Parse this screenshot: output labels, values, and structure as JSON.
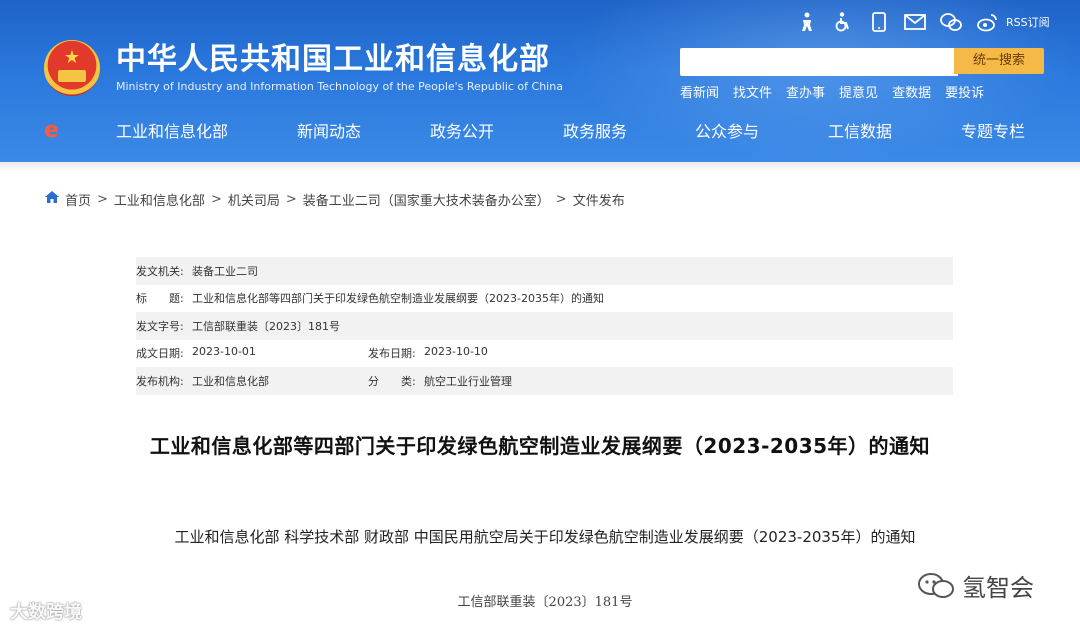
{
  "header": {
    "site_title": "中华人民共和国工业和信息化部",
    "site_subtitle": "Ministry of Industry and Information Technology of the People's Republic of China",
    "top_icons": [
      "elder-icon",
      "accessibility-icon",
      "mobile-icon",
      "mail-icon",
      "wechat-icon",
      "weibo-icon"
    ],
    "rss_label": "RSS订阅",
    "search": {
      "placeholder": "",
      "button_label": "统一搜索"
    },
    "quick_links": [
      "看新闻",
      "找文件",
      "查办事",
      "提意见",
      "查数据",
      "要投诉"
    ],
    "nav": [
      "工业和信息化部",
      "新闻动态",
      "政务公开",
      "政务服务",
      "公众参与",
      "工信数据",
      "专题专栏"
    ]
  },
  "breadcrumb": {
    "items": [
      "首页",
      "工业和信息化部",
      "机关司局",
      "装备工业二司（国家重大技术装备办公室）",
      "文件发布"
    ]
  },
  "info": {
    "issuer_label": "发文机关:",
    "issuer": "装备工业二司",
    "title_label": "标　　题:",
    "title": "工业和信息化部等四部门关于印发绿色航空制造业发展纲要（2023-2035年）的通知",
    "doc_no_label": "发文字号:",
    "doc_no": "工信部联重装〔2023〕181号",
    "created_label": "成文日期:",
    "created": "2023-10-01",
    "published_label": "发布日期:",
    "published": "2023-10-10",
    "org_label": "发布机构:",
    "org": "工业和信息化部",
    "category_label": "分　　类:",
    "category": "航空工业行业管理"
  },
  "article": {
    "title": "工业和信息化部等四部门关于印发绿色航空制造业发展纲要（2023-2035年）的通知",
    "subtitle": "工业和信息化部 科学技术部 财政部 中国民用航空局关于印发绿色航空制造业发展纲要（2023-2035年）的通知",
    "doc_number": "工信部联重装〔2023〕181号"
  },
  "watermarks": {
    "left": "大数跨境",
    "right": "氢智会"
  }
}
